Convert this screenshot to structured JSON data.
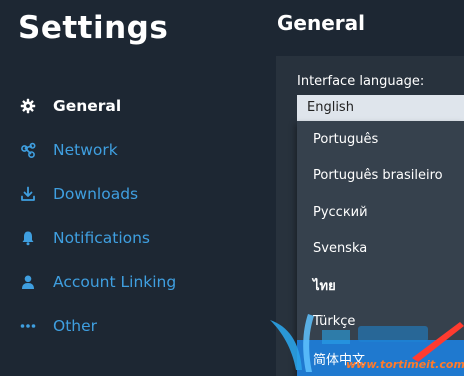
{
  "sidebar": {
    "title": "Settings",
    "items": [
      {
        "label": "General",
        "icon": "gear-icon",
        "active": true
      },
      {
        "label": "Network",
        "icon": "network-icon",
        "active": false
      },
      {
        "label": "Downloads",
        "icon": "download-icon",
        "active": false
      },
      {
        "label": "Notifications",
        "icon": "bell-icon",
        "active": false
      },
      {
        "label": "Account Linking",
        "icon": "person-icon",
        "active": false
      },
      {
        "label": "Other",
        "icon": "ellipsis-icon",
        "active": false
      }
    ]
  },
  "main": {
    "title": "General",
    "language_field": {
      "label": "Interface language:",
      "selected": "English",
      "options": [
        "Português",
        "Português brasileiro",
        "Русский",
        "Svenska",
        "ไทย",
        "Türkçe",
        "简体中文"
      ]
    }
  },
  "watermark": {
    "text": "www.tortimeit.com"
  },
  "colors": {
    "background": "#1d2733",
    "panel": "#28323d",
    "dropdown": "#36414d",
    "accent": "#3f9fe0",
    "highlight": "#1f79cf",
    "select_bg": "#dfe5ec"
  }
}
